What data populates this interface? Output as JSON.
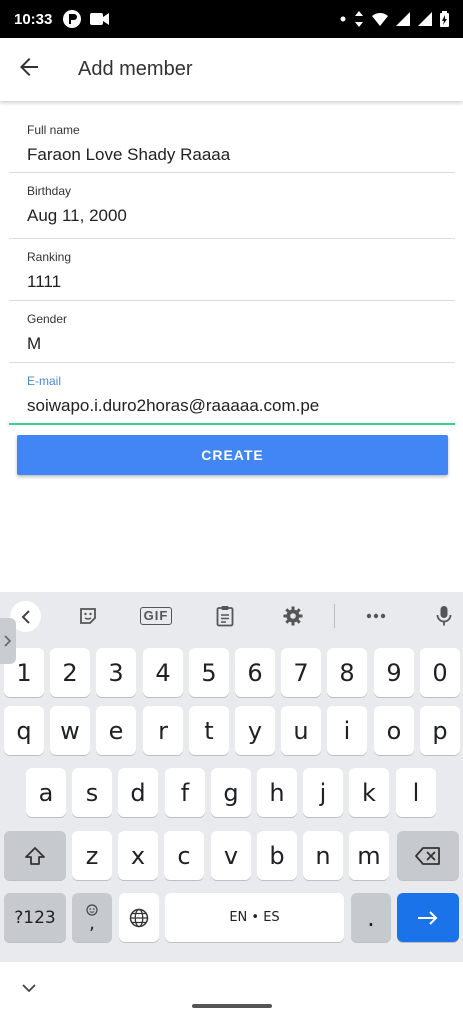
{
  "status_bar": {
    "time": "10:33",
    "left_icons": [
      "app-notification-icon",
      "video-camera-icon"
    ],
    "right_icons": [
      "dot-icon",
      "data-arrows-icon",
      "wifi-icon",
      "signal-icon",
      "signal-icon",
      "battery-icon"
    ]
  },
  "app_bar": {
    "title": "Add member",
    "back_icon": "arrow-back-icon"
  },
  "form": {
    "fields": [
      {
        "label": "Full name",
        "value": "Faraon Love Shady Raaaa"
      },
      {
        "label": "Birthday",
        "value": "Aug 11, 2000"
      },
      {
        "label": "Ranking",
        "value": "1111"
      },
      {
        "label": "Gender",
        "value": "M"
      },
      {
        "label": "E-mail",
        "value": "soiwapo.i.duro2horas@raaaaa.com.pe"
      }
    ],
    "active_field_color": "#3ecf8e",
    "active_label_color": "#4a8ad6"
  },
  "create_button": {
    "label": "CREATE",
    "color": "#4285f4"
  },
  "keyboard": {
    "toolbar": {
      "items": [
        "chevron-left-icon",
        "sticker-icon",
        "GIF",
        "clipboard-icon",
        "gear-icon",
        "more-icon",
        "microphone-icon"
      ]
    },
    "rows": {
      "numbers": [
        "1",
        "2",
        "3",
        "4",
        "5",
        "6",
        "7",
        "8",
        "9",
        "0"
      ],
      "row1": [
        "q",
        "w",
        "e",
        "r",
        "t",
        "y",
        "u",
        "i",
        "o",
        "p"
      ],
      "row2": [
        "a",
        "s",
        "d",
        "f",
        "g",
        "h",
        "j",
        "k",
        "l"
      ],
      "row3": [
        "z",
        "x",
        "c",
        "v",
        "b",
        "n",
        "m"
      ]
    },
    "symbols_key": "?123",
    "comma_key": ",",
    "space_label": "EN • ES",
    "period_key": ".",
    "enter_color": "#1a73e8"
  }
}
